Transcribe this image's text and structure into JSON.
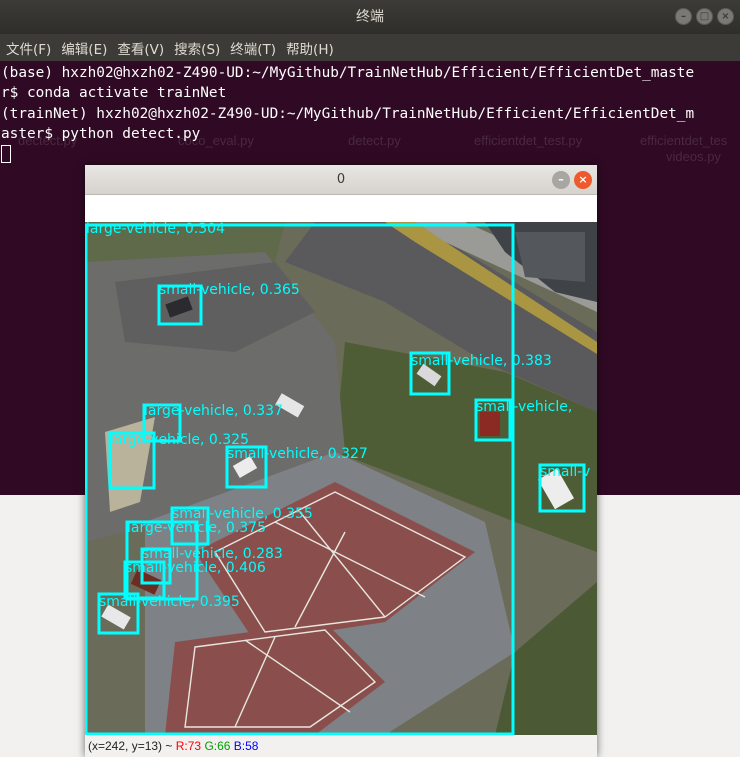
{
  "terminal": {
    "title": "终端",
    "menu": [
      "文件(F)",
      "编辑(E)",
      "查看(V)",
      "搜索(S)",
      "终端(T)",
      "帮助(H)"
    ],
    "lines": [
      "(base) hxzh02@hxzh02-Z490-UD:~/MyGithub/TrainNetHub/Efficient/EfficientDet_maste",
      "r$ conda activate trainNet",
      "(trainNet) hxzh02@hxzh02-Z490-UD:~/MyGithub/TrainNetHub/Efficient/EfficientDet_m",
      "aster$ python detect.py"
    ],
    "background_files": [
      "dectect.py",
      "coco_eval.py",
      "detect.py",
      "efficientdet_test.py",
      "efficientdet_tes",
      "videos.py"
    ],
    "colors": {
      "background": "#300a24",
      "text": "#ffffff"
    }
  },
  "image_window": {
    "title": "0",
    "status": {
      "coords": "(x=242, y=13) ~",
      "r": "R:73",
      "g": "G:66",
      "b": "B:58"
    },
    "status_colors": {
      "r": "#ff0000",
      "g": "#00a000",
      "b": "#0000ff"
    },
    "box_color": "#00ffff",
    "detections": [
      {
        "label": "large-vehicle, 0.304"
      },
      {
        "label": "small-vehicle, 0.365"
      },
      {
        "label": "small-vehicle, 0.383"
      },
      {
        "label": "small-vehicle,"
      },
      {
        "label": "large-vehicle, 0.337"
      },
      {
        "label": "large-vehicle, 0.325"
      },
      {
        "label": "small-vehicle, 0.327"
      },
      {
        "label": "small-v"
      },
      {
        "label": "small-vehicle, 0.355"
      },
      {
        "label": "large-vehicle, 0.375"
      },
      {
        "label": "small-vehicle, 0.283"
      },
      {
        "label": "small-vehicle, 0.406"
      },
      {
        "label": "small-vehicle, 0.395"
      }
    ]
  }
}
